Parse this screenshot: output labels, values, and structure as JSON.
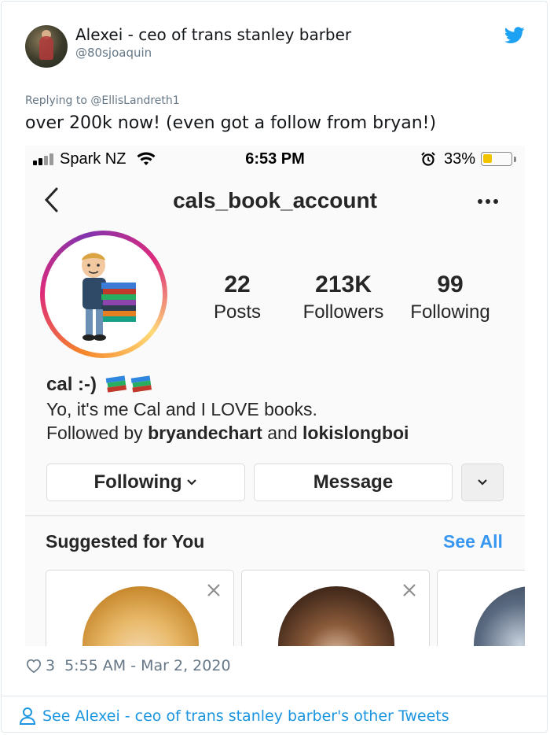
{
  "tweet": {
    "author_name": "Alexei - ceo of trans stanley barber",
    "author_handle": "@80sjoaquin",
    "replying_to": "Replying to @EllisLandreth1",
    "text": "over 200k now! (even got a follow from bryan!)",
    "likes": "3",
    "timestamp": "5:55 AM - Mar 2, 2020",
    "see_other": "See Alexei - ceo of trans stanley barber's other Tweets",
    "brand_color": "#1da1f2",
    "link_color": "#1b95e0"
  },
  "screenshot": {
    "status_bar": {
      "carrier": "Spark NZ",
      "time": "6:53 PM",
      "battery": "33%",
      "battery_level": 0.33,
      "icons": [
        "signal-icon",
        "wifi-icon",
        "alarm-icon",
        "battery-icon"
      ]
    },
    "profile": {
      "username": "cals_book_account",
      "stats": [
        {
          "value": "22",
          "label": "Posts"
        },
        {
          "value": "213K",
          "label": "Followers"
        },
        {
          "value": "99",
          "label": "Following"
        }
      ],
      "bio_name": "cal :-)",
      "bio_text": "Yo, it's me Cal and I LOVE books.",
      "followed_by_prefix": "Followed by",
      "followed_by_user1": "bryandechart",
      "followed_by_and": "and",
      "followed_by_user2": "lokislongboi"
    },
    "buttons": {
      "following": "Following",
      "message": "Message"
    },
    "suggested": {
      "title": "Suggested for You",
      "see_all": "See All",
      "accent": "#3897f0"
    },
    "story_ring_colors": [
      "#f58529",
      "#dd2a7b",
      "#8134af",
      "#feda77"
    ]
  }
}
